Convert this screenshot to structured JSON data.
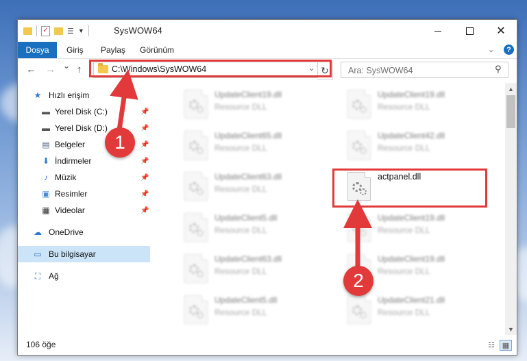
{
  "window": {
    "title": "SysWOW64",
    "minimize_icon": "minimize-icon",
    "maximize_icon": "maximize-icon",
    "close_icon": "close-icon"
  },
  "quick_access_toolbar": {
    "icons": [
      "folder-icon",
      "properties-check-icon",
      "new-folder-icon",
      "customize-icon",
      "dropdown-arrow-icon"
    ]
  },
  "ribbon": {
    "tabs": [
      {
        "label": "Dosya",
        "active": true
      },
      {
        "label": "Giriş"
      },
      {
        "label": "Paylaş"
      },
      {
        "label": "Görünüm"
      }
    ],
    "expand_icon": "chevron-down-icon",
    "help_icon": "help-icon",
    "help_label": "?"
  },
  "navigation": {
    "back_icon": "←",
    "forward_icon": "→",
    "recent_icon": "⌄",
    "up_icon": "↑",
    "address": "C:\\Windows\\SysWOW64",
    "address_dropdown": "⌄",
    "refresh_icon": "↻",
    "search_placeholder": "Ara: SysWOW64",
    "search_icon": "⚲"
  },
  "sidebar": {
    "items": [
      {
        "label": "Hızlı erişim",
        "icon": "★",
        "pinned": false
      },
      {
        "label": "Yerel Disk (C:)",
        "icon": "▬",
        "pinned": true
      },
      {
        "label": "Yerel Disk (D:)",
        "icon": "▬",
        "pinned": true
      },
      {
        "label": "Belgeler",
        "icon": "▤",
        "pinned": true
      },
      {
        "label": "İndirmeler",
        "icon": "⬇",
        "pinned": true
      },
      {
        "label": "Müzik",
        "icon": "♪",
        "pinned": true
      },
      {
        "label": "Resimler",
        "icon": "▣",
        "pinned": true
      },
      {
        "label": "Videolar",
        "icon": "▦",
        "pinned": true
      },
      {
        "label": "OneDrive",
        "icon": "☁",
        "pinned": false
      },
      {
        "label": "Bu bilgisayar",
        "icon": "▭",
        "pinned": false,
        "selected": true
      },
      {
        "label": "Ağ",
        "icon": "⛶",
        "pinned": false
      }
    ],
    "pin_glyph": "📌"
  },
  "files": [
    {
      "name": "UpdateClient19.dll",
      "type": "Resource DLL"
    },
    {
      "name": "UpdateClient19.dll",
      "type": "Resource DLL"
    },
    {
      "name": "UpdateClient65.dll",
      "type": "Resource DLL"
    },
    {
      "name": "UpdateClient42.dll",
      "type": "Resource DLL"
    },
    {
      "name": "UpdateClient63.dll",
      "type": "Resource DLL"
    },
    {
      "name": "actpanel.dll",
      "type": "",
      "highlighted": true
    },
    {
      "name": "UpdateClient5.dll",
      "type": "Resource DLL"
    },
    {
      "name": "UpdateClient19.dll",
      "type": "Resource DLL"
    },
    {
      "name": "UpdateClient63.dll",
      "type": "Resource DLL"
    },
    {
      "name": "UpdateClient19.dll",
      "type": "Resource DLL"
    },
    {
      "name": "UpdateClient5.dll",
      "type": "Resource DLL"
    },
    {
      "name": "UpdateClient21.dll",
      "type": "Resource DLL"
    }
  ],
  "status": {
    "item_count": "106 öğe",
    "details_view_icon": "details-view-icon",
    "large_icons_view_icon": "large-icons-view-icon"
  },
  "annotations": {
    "step1": "1",
    "step2": "2",
    "color": "#e23a3a"
  }
}
